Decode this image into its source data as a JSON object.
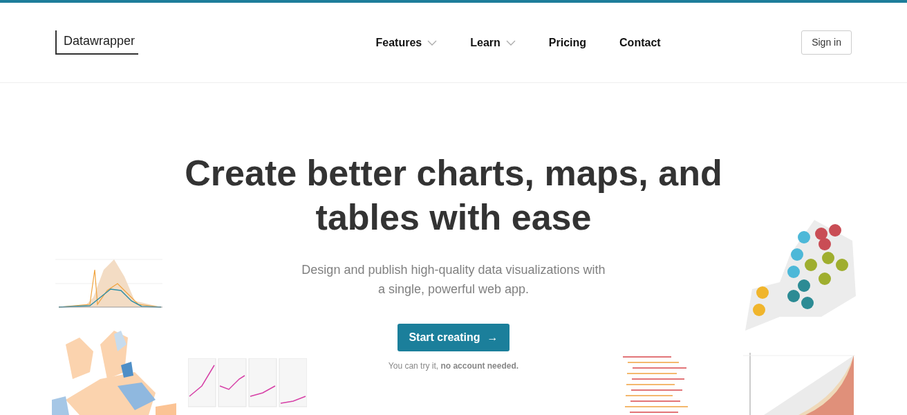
{
  "header": {
    "logo": "Datawrapper",
    "nav": [
      {
        "label": "Features",
        "has_dropdown": true
      },
      {
        "label": "Learn",
        "has_dropdown": true
      },
      {
        "label": "Pricing",
        "has_dropdown": false
      },
      {
        "label": "Contact",
        "has_dropdown": false
      }
    ],
    "sign_in": "Sign in"
  },
  "hero": {
    "title": "Create better charts, maps, and tables with ease",
    "subtitle": "Design and publish high-quality data visualizations with a single, powerful web app.",
    "cta": "Start creating",
    "cta_arrow": "→",
    "note": "You can try it, **no account needed.**"
  }
}
